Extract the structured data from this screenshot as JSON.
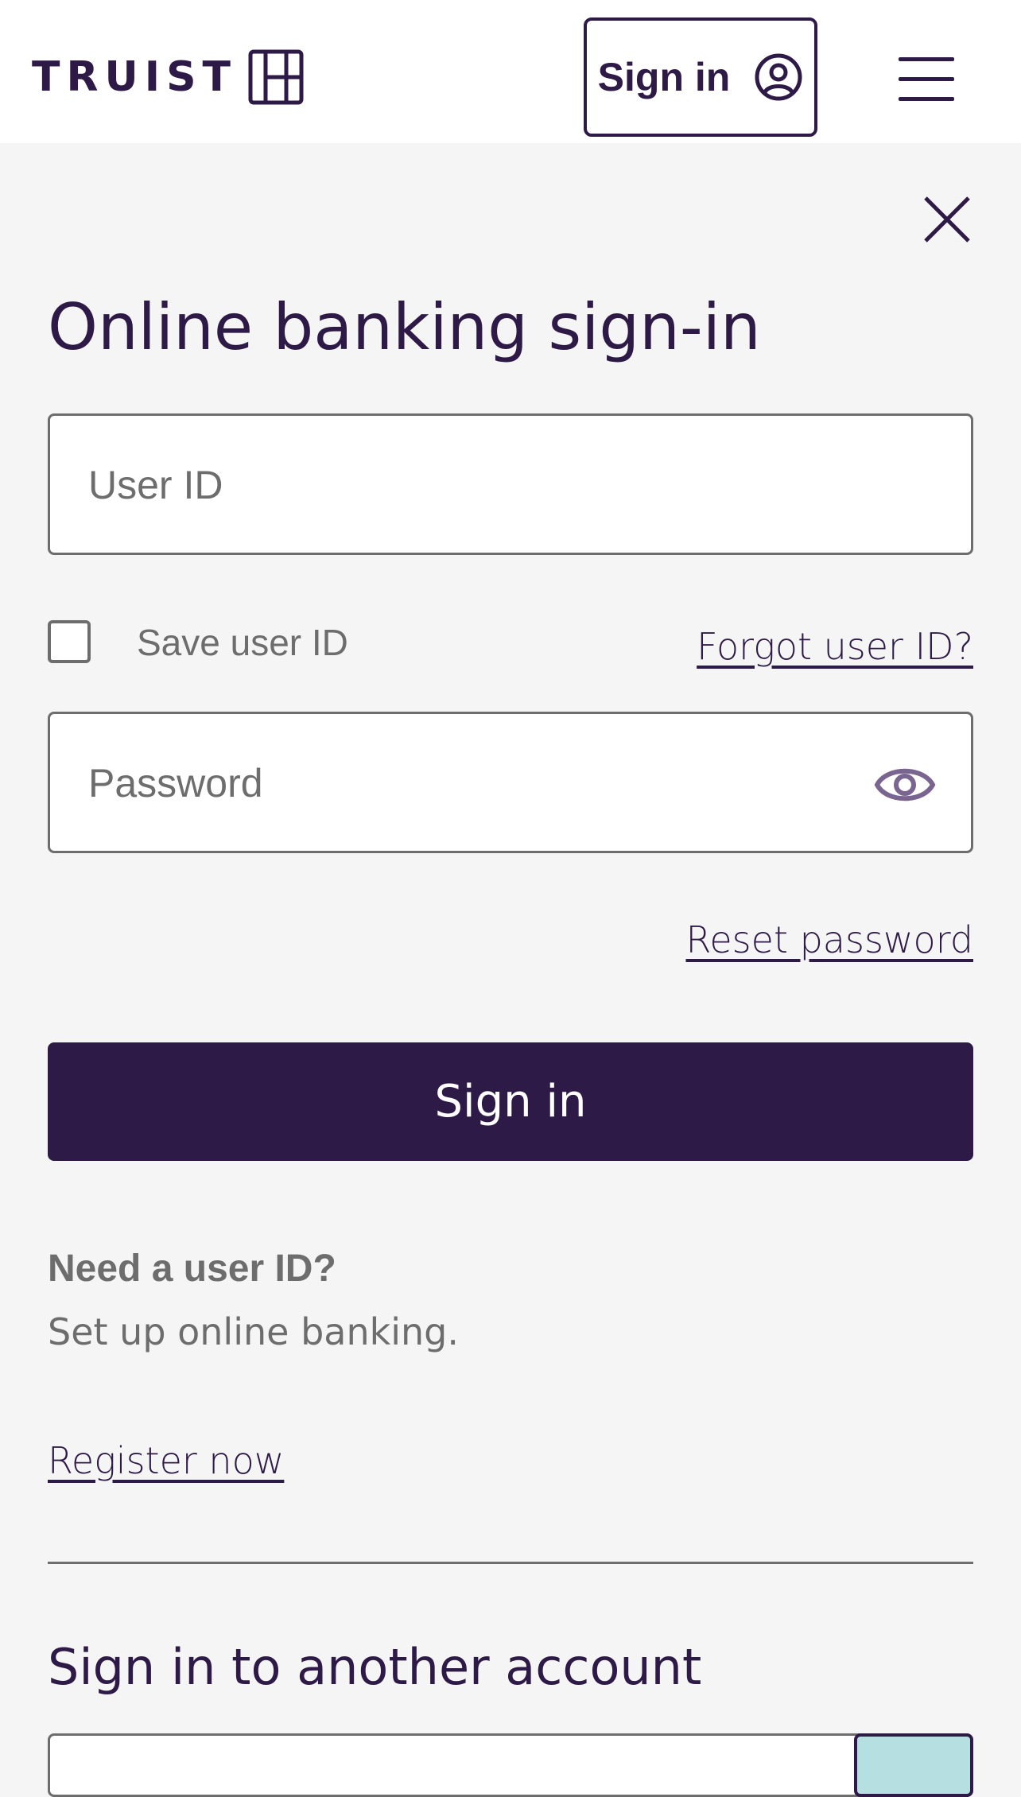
{
  "header": {
    "logo_text": "TRUIST",
    "signin_label": "Sign in",
    "icons": {
      "logo_mark": "truist-logo-mark-icon",
      "user": "user-circle-icon",
      "menu": "hamburger-menu-icon"
    }
  },
  "panel": {
    "title": "Online banking sign-in",
    "user_id_placeholder": "User ID",
    "save_user_id_label": "Save user ID",
    "forgot_user_id_link": "Forgot user ID?",
    "password_placeholder": "Password",
    "reset_password_link": "Reset password",
    "signin_button": "Sign in",
    "need_user_id_heading": "Need a user ID?",
    "need_user_id_text": "Set up online banking.",
    "register_link": "Register now",
    "another_account_title": "Sign in to another account"
  },
  "colors": {
    "brand_purple": "#2e1a47",
    "background": "#f5f5f5",
    "muted_text": "#6d6d6d",
    "teal_accent": "#b5dfe0"
  }
}
